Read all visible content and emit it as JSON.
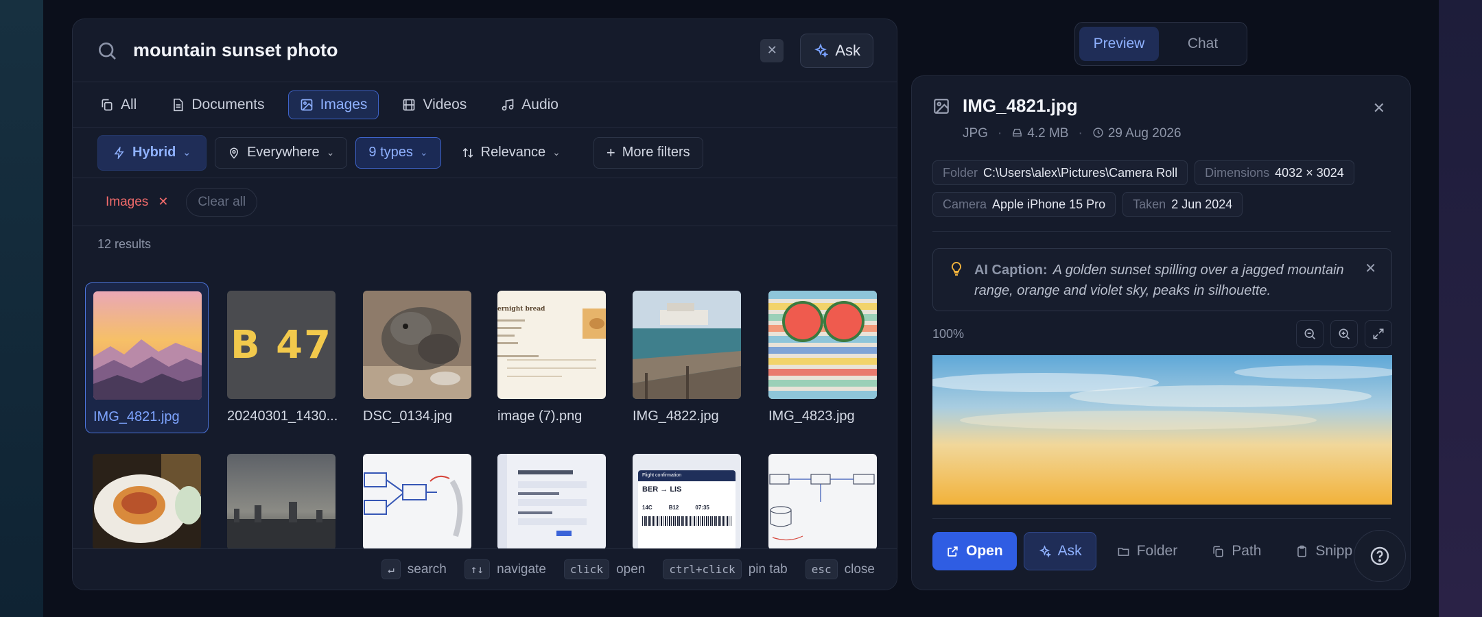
{
  "search": {
    "query": "mountain sunset photo",
    "ask_label": "Ask"
  },
  "tabs": [
    {
      "label": "All",
      "icon": "copy-icon"
    },
    {
      "label": "Documents",
      "icon": "document-icon"
    },
    {
      "label": "Images",
      "icon": "image-icon",
      "active": true
    },
    {
      "label": "Videos",
      "icon": "film-icon"
    },
    {
      "label": "Audio",
      "icon": "music-icon"
    }
  ],
  "filters": {
    "mode": "Hybrid",
    "location": "Everywhere",
    "types": "9 types",
    "sort": "Relevance",
    "more": "More filters"
  },
  "active_filters": {
    "tag": "Images",
    "clear_all": "Clear all"
  },
  "results": {
    "count_label": "12 results",
    "items": [
      {
        "name": "IMG_4821.jpg",
        "selected": true
      },
      {
        "name": "20240301_1430..."
      },
      {
        "name": "DSC_0134.jpg"
      },
      {
        "name": "image (7).png"
      },
      {
        "name": "IMG_4822.jpg"
      },
      {
        "name": "IMG_4823.jpg"
      }
    ],
    "bib_text": "B 47",
    "doc_title": "ernight bread",
    "flight_header": "Flight confirmation",
    "flight_route": "BER → LIS",
    "flight_seat": "14C",
    "flight_gate": "B12",
    "flight_time": "07:35"
  },
  "hints": [
    {
      "key": "↵",
      "label": "search"
    },
    {
      "key": "↑↓",
      "label": "navigate"
    },
    {
      "key": "click",
      "label": "open"
    },
    {
      "key": "ctrl+click",
      "label": "pin tab"
    },
    {
      "key": "esc",
      "label": "close"
    }
  ],
  "mode_toggle": {
    "preview": "Preview",
    "chat": "Chat"
  },
  "preview": {
    "title": "IMG_4821.jpg",
    "format": "JPG",
    "size": "4.2 MB",
    "date": "29 Aug 2026",
    "tags": [
      {
        "k": "Folder",
        "v": "C:\\Users\\alex\\Pictures\\Camera Roll"
      },
      {
        "k": "Dimensions",
        "v": "4032 × 3024"
      },
      {
        "k": "Camera",
        "v": "Apple iPhone 15 Pro"
      },
      {
        "k": "Taken",
        "v": "2 Jun 2024"
      }
    ],
    "caption_label": "AI Caption:",
    "caption_text": "A golden sunset spilling over a jagged mountain range, orange and violet sky, peaks in silhouette.",
    "zoom": "100%",
    "actions": {
      "open": "Open",
      "ask": "Ask",
      "folder": "Folder",
      "path": "Path",
      "snippet": "Snipp"
    }
  },
  "colors": {
    "accent": "#2f5de3",
    "accent_soft": "#8fb1ff",
    "danger": "#f26b6b"
  }
}
